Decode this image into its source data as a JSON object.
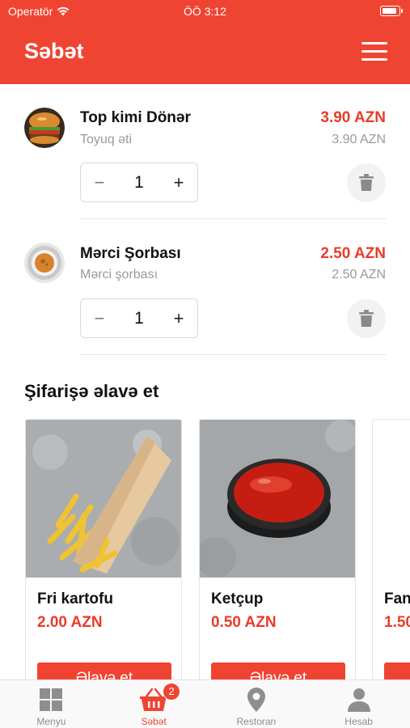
{
  "status_bar": {
    "carrier": "Operatör",
    "time": "ÖÖ 3:12"
  },
  "header": {
    "title": "Səbət"
  },
  "cart": {
    "items": [
      {
        "name": "Top kimi Dönər",
        "subtitle": "Toyuq əti",
        "total": "3.90 AZN",
        "unit_price": "3.90 AZN",
        "quantity": "1"
      },
      {
        "name": "Mərci Şorbası",
        "subtitle": "Mərci şorbası",
        "total": "2.50 AZN",
        "unit_price": "2.50 AZN",
        "quantity": "1"
      }
    ],
    "minus_symbol": "−",
    "plus_symbol": "+"
  },
  "suggestions": {
    "title": "Şifarişə əlavə et",
    "add_label": "Əlavə et",
    "items": [
      {
        "name": "Fri kartofu",
        "price": "2.00 AZN"
      },
      {
        "name": "Ketçup",
        "price": "0.50 AZN"
      },
      {
        "name": "Fan",
        "price": "1.50"
      }
    ]
  },
  "tabbar": {
    "tabs": [
      {
        "label": "Menyu",
        "icon": "grid-icon"
      },
      {
        "label": "Səbət",
        "icon": "basket-icon",
        "badge": "2"
      },
      {
        "label": "Restoran",
        "icon": "location-pin-icon"
      },
      {
        "label": "Hesab",
        "icon": "person-icon"
      }
    ],
    "active_index": 1
  },
  "colors": {
    "brand": "#f04433",
    "price": "#ea3b2b",
    "muted": "#9a9a9a"
  }
}
